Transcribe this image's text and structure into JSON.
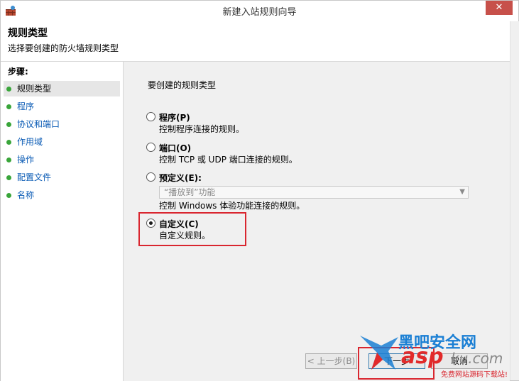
{
  "window": {
    "title": "新建入站规则向导",
    "close_label": "✕"
  },
  "header": {
    "title": "规则类型",
    "subtitle": "选择要创建的防火墙规则类型"
  },
  "steps": {
    "heading": "步骤:",
    "items": [
      {
        "label": "规则类型",
        "active": true
      },
      {
        "label": "程序",
        "active": false
      },
      {
        "label": "协议和端口",
        "active": false
      },
      {
        "label": "作用域",
        "active": false
      },
      {
        "label": "操作",
        "active": false
      },
      {
        "label": "配置文件",
        "active": false
      },
      {
        "label": "名称",
        "active": false
      }
    ]
  },
  "content": {
    "prompt": "要创建的规则类型",
    "options": [
      {
        "label": "程序(P)",
        "desc": "控制程序连接的规则。",
        "checked": false
      },
      {
        "label": "端口(O)",
        "desc": "控制 TCP 或 UDP 端口连接的规则。",
        "checked": false
      },
      {
        "label": "预定义(E):",
        "desc": "控制 Windows 体验功能连接的规则。",
        "checked": false
      },
      {
        "label": "自定义(C)",
        "desc": "自定义规则。",
        "checked": true
      }
    ],
    "predefined_select": "“播放到”功能"
  },
  "buttons": {
    "back": "< 上一步(B)",
    "next": "下一步",
    "cancel": "取消"
  },
  "watermark": {
    "title": "黑吧安全网",
    "asp": "asp",
    "domain": "ku.com",
    "sub": "免费网站源码下载站!"
  }
}
